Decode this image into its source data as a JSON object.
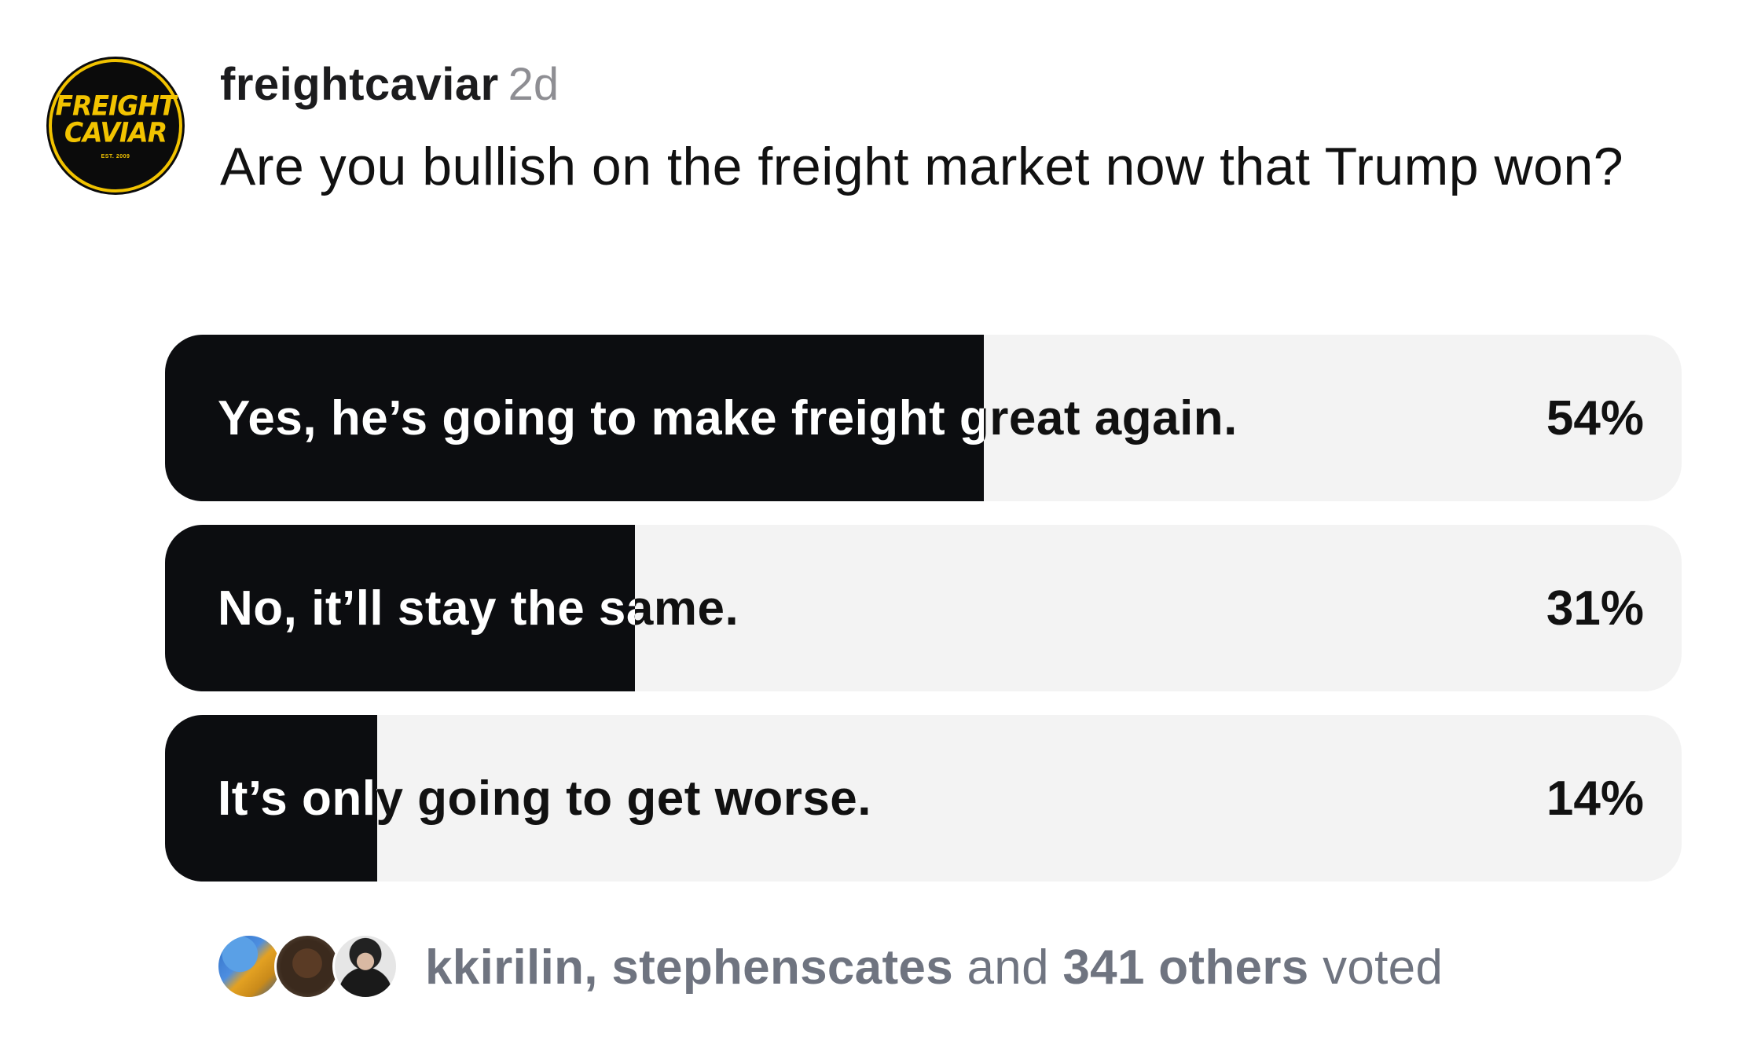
{
  "post": {
    "avatar": {
      "line1": "FREIGHT",
      "line2": "CAVIAR",
      "est": "EST. 2009",
      "colors": {
        "background": "#0b0b0b",
        "accent": "#f2c300"
      }
    },
    "username": "freightcaviar",
    "timestamp": "2d",
    "question": "Are you bullish on the freight market now that Trump won?"
  },
  "poll": {
    "options": [
      {
        "label": "Yes, he’s going to make freight great again.",
        "percent_label": "54%",
        "percent": 54
      },
      {
        "label": "No, it’ll stay the same.",
        "percent_label": "31%",
        "percent": 31
      },
      {
        "label": "It’s only going to get worse.",
        "percent_label": "14%",
        "percent": 14
      }
    ],
    "colors": {
      "fill": "#0c0d10",
      "track": "#f3f3f3"
    }
  },
  "voters": {
    "names": "kkirilin, stephenscates",
    "joiner": " and ",
    "others": "341 others",
    "suffix": " voted"
  }
}
